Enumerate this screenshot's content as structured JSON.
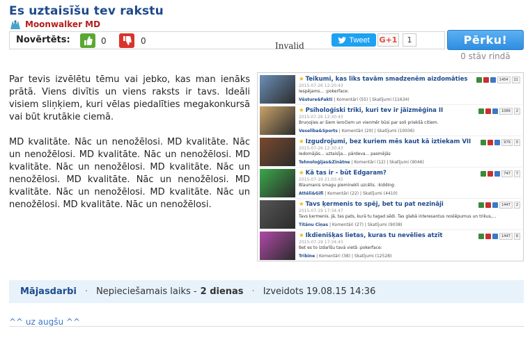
{
  "page": {
    "title": "Es uztaisīšu tev rakstu",
    "author": "Moonwalker MD"
  },
  "rating": {
    "label": "Novērtēts:",
    "likes": "0",
    "dislikes": "0",
    "overlay_text": "Invalid"
  },
  "share": {
    "tweet_label": "Tweet",
    "gplus_label": "G+1",
    "gplus_count": "1"
  },
  "order": {
    "buy_label": "Pērku!",
    "queue_text": "0 stāv rindā"
  },
  "description": {
    "paragraph1": "Par tevis izvēlētu tēmu vai jebko, kas man ienāks prātā. Viens divītis un viens raksts ir tavs. Ideāli visiem sliņķiem, kuri vēlas piedalīties megakonkursā vai būt krutākie ciemā.",
    "paragraph2": "MD kvalitāte. Nāc un nenožēlosi. MD kvalitāte. Nāc un nenožēlosi. MD kvalitāte. Nāc un nenožēlosi. MD kvalitāte. Nāc un nenožēlosi. MD kvalitāte. Nāc un nenožēlosi. MD kvalitāte. Nāc un nenožēlosi. MD kvalitāte. Nāc un nenožēlosi. MD kvalitāte. Nāc un nenožēlosi. MD kvalitāte. Nāc un nenožēlosi."
  },
  "preview": {
    "items": [
      {
        "title": "Teikumi, kas liks tavām smadzenēm aizdomāties",
        "date": "2015-07-26 12:20:43",
        "text": "Iespējams... :pokerface:",
        "category": "Vēsture&Fakti",
        "comments": "Komentāri (55)",
        "views": "Skatījumi (11634)",
        "score": "1454",
        "count": "11",
        "thumb_color": "#6b8fb8"
      },
      {
        "title": "Psiholoģiski triki, kuri tev ir jāizmēģina II",
        "date": "2015-07-26 12:30:43",
        "text": "Bruņojies ar šiem ieročiem un vienmēr būsi par soli priekšā citiem.",
        "category": "Veselība&Sports",
        "comments": "Komentāri (20)",
        "views": "Skatījumi (10036)",
        "score": "1089",
        "count": "2",
        "thumb_color": "#c9a36a"
      },
      {
        "title": "Izgudrojumi, bez kuriem mēs kaut kā iztiekam VII",
        "date": "2015-07-26 12:30:43",
        "text": "Iedomājās... uztaisīja... pārdeva... pasmējās",
        "category": "Tehnoloģijas&Zinātne",
        "comments": "Komentāri (12)",
        "views": "Skatījumi (9046)",
        "score": "979",
        "count": "0",
        "thumb_color": "#7a4a2e"
      },
      {
        "title": "Kā tas ir - būt Edgaram?",
        "date": "2015-07-19 21:03:45",
        "text": "Blaumanis smagu pieminekli uzcēlis. :kidding:",
        "category": "Attēli&Gifi",
        "comments": "Komentāri (22)",
        "views": "Skatījumi (4410)",
        "score": "747",
        "count": "7",
        "thumb_color": "#3aa84a"
      },
      {
        "title": "Tavs ķermenis to spēj, bet tu pat nezināji",
        "date": "2015-07-19 17:34:47",
        "text": "Tavs ķermenis. Jā, tas pats, kurā tu tagad sēdi. Tas glabā interesantus noslēpumus un trikus,...",
        "category": "Titānu Cīņas",
        "comments": "Komentāri (27)",
        "views": "Skatījumi (9038)",
        "score": "1447",
        "count": "2",
        "thumb_color": "#555555"
      },
      {
        "title": "Ikdienišķas lietas, kuras tu nevēlies atzīt",
        "date": "2015-07-19 17:34:43",
        "text": "Bet es to izdarīšu tavā vietā :pokerface:",
        "category": "Tribīne",
        "comments": "Komentāri (38)",
        "views": "Skatījumi (12528)",
        "score": "1447",
        "count": "6",
        "thumb_color": "#b04aa8"
      }
    ]
  },
  "footer": {
    "category": "Mājasdarbi",
    "time_label": "Nepieciešamais laiks -",
    "time_value": "2 dienas",
    "created": "Izveidots 19.08.15 14:36"
  },
  "nav": {
    "back_to_top": "^^ uz augšu ^^"
  },
  "colors": {
    "title": "#1d4a8c",
    "author": "#b51c1c",
    "buy_button": "#2e8ee0",
    "like": "#5aa832",
    "dislike": "#d9342b",
    "footer_bg": "#e8f2fb"
  }
}
